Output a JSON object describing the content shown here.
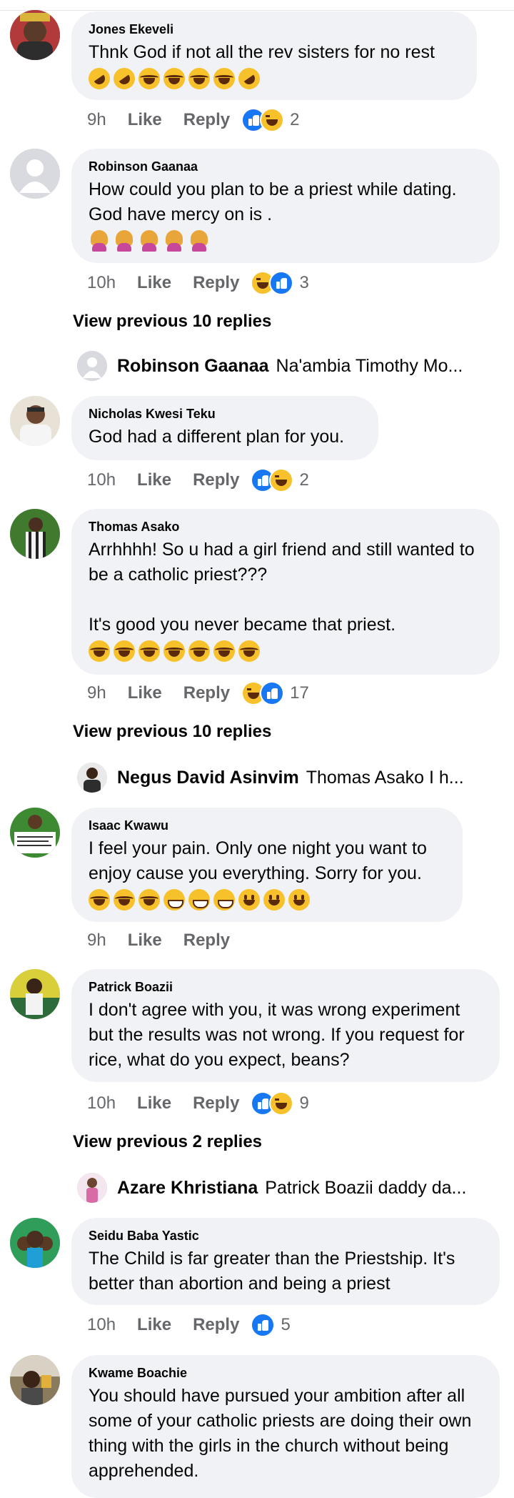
{
  "comments": [
    {
      "author": "Jones Ekeveli",
      "text": "Thnk God if not all the rev sisters for no rest",
      "emojis": [
        "rofl",
        "rofl",
        "laugh",
        "laugh",
        "laugh",
        "laugh",
        "rofl"
      ],
      "time": "9h",
      "like": "Like",
      "reply": "Reply",
      "reactions": [
        "like",
        "haha"
      ],
      "reaction_count": "2"
    },
    {
      "author": "Robinson Gaanaa",
      "text": "How could you plan to be a priest while dating. God have mercy on is .",
      "emojis": [
        "facepalm",
        "facepalm",
        "facepalm",
        "facepalm",
        "facepalm"
      ],
      "time": "10h",
      "like": "Like",
      "reply": "Reply",
      "reactions": [
        "haha",
        "like"
      ],
      "reaction_count": "3",
      "view_previous": "View previous 10 replies",
      "reply_preview": {
        "name": "Robinson Gaanaa",
        "text": "Na'ambia Timothy Mo..."
      }
    },
    {
      "author": "Nicholas Kwesi Teku",
      "text": "God had a different plan for you.",
      "emojis": [],
      "time": "10h",
      "like": "Like",
      "reply": "Reply",
      "reactions": [
        "like",
        "haha"
      ],
      "reaction_count": "2"
    },
    {
      "author": "Thomas Asako",
      "text": "Arrhhhh! So u had a girl friend and still wanted to be a catholic priest???\n\nIt's good you never became that priest.",
      "emojis": [
        "laugh",
        "laugh",
        "laugh",
        "laugh",
        "laugh",
        "laugh",
        "laugh"
      ],
      "time": "9h",
      "like": "Like",
      "reply": "Reply",
      "reactions": [
        "haha",
        "like"
      ],
      "reaction_count": "17",
      "view_previous": "View previous 10 replies",
      "reply_preview": {
        "name": "Negus David Asinvim",
        "text": "Thomas Asako I h..."
      }
    },
    {
      "author": "Isaac Kwawu",
      "text": "I feel your pain. Only one night you want to enjoy cause you everything. Sorry for you.",
      "emojis": [
        "laugh",
        "laugh",
        "laugh",
        "grin",
        "grin",
        "grin",
        "smile",
        "smile",
        "smile"
      ],
      "time": "9h",
      "like": "Like",
      "reply": "Reply",
      "reactions": [],
      "reaction_count": ""
    },
    {
      "author": "Patrick Boazii",
      "text": "I don't agree with you, it was wrong experiment but the results was not wrong. If you request for rice, what do you expect, beans?",
      "emojis": [],
      "time": "10h",
      "like": "Like",
      "reply": "Reply",
      "reactions": [
        "like",
        "haha"
      ],
      "reaction_count": "9",
      "view_previous": "View previous 2 replies",
      "reply_preview": {
        "name": "Azare Khristiana",
        "text": "Patrick Boazii daddy da..."
      }
    },
    {
      "author": "Seidu Baba Yastic",
      "text": "The Child is far greater than the Priestship. It's better than abortion and being a priest",
      "emojis": [],
      "time": "10h",
      "like": "Like",
      "reply": "Reply",
      "reactions": [
        "like"
      ],
      "reaction_count": "5"
    },
    {
      "author": "Kwame Boachie",
      "text": "You should have pursued your ambition after all some of your catholic priests are doing their own thing with the girls in the church without being apprehended.",
      "emojis": [],
      "time": "",
      "like": "",
      "reply": "",
      "reactions": [],
      "reaction_count": ""
    }
  ],
  "colors": {
    "bubble": "#f0f2f5",
    "meta": "#65676b",
    "text": "#050505",
    "like_blue": "#1877f2",
    "haha_yellow": "#f7c12b"
  }
}
